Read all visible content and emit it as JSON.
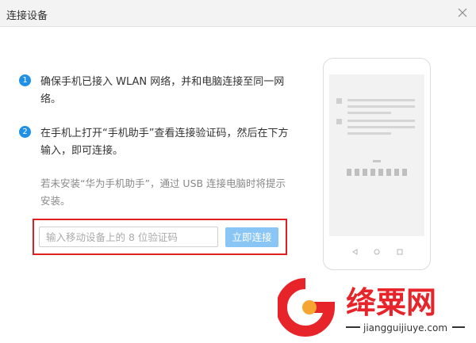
{
  "dialog": {
    "title": "连接设备"
  },
  "steps": [
    {
      "num": "1",
      "text": "确保手机已接入 WLAN 网络，并和电脑连接至同一网络。"
    },
    {
      "num": "2",
      "text": "在手机上打开“手机助手”查看连接验证码，然后在下方输入，即可连接。"
    }
  ],
  "note": "若未安装“华为手机助手”，通过 USB 连接电脑时将提示安装。",
  "code_input": {
    "placeholder": "输入移动设备上的 8 位验证码",
    "value": ""
  },
  "connect_button": {
    "label": "立即连接"
  },
  "icons": {
    "close": "close-icon",
    "phone": "phone-illustration"
  },
  "colors": {
    "accent": "#1f8fe8",
    "button": "#8ac6f5",
    "highlight": "#e02020",
    "watermark_brand": "#e8242b"
  },
  "watermark": {
    "name": "绛粟网",
    "site": "jiangguijiuye.com"
  }
}
